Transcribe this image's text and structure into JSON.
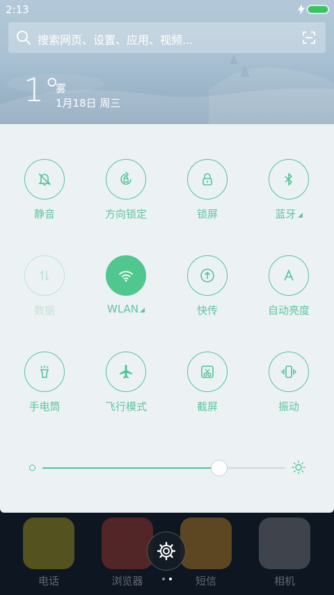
{
  "status": {
    "time": "2:13"
  },
  "search": {
    "placeholder": "搜索网页、设置、应用、视频..."
  },
  "weather": {
    "temp": "1°",
    "condition": "雾",
    "date": "1月18日 周三"
  },
  "toggles": [
    {
      "id": "mute",
      "label": "静音",
      "icon": "bell-off-icon",
      "state": "off"
    },
    {
      "id": "rotation-lock",
      "label": "方向锁定",
      "icon": "rotation-lock-icon",
      "state": "off"
    },
    {
      "id": "lock-screen",
      "label": "锁屏",
      "icon": "lock-icon",
      "state": "off"
    },
    {
      "id": "bluetooth",
      "label": "蓝牙",
      "icon": "bluetooth-icon",
      "state": "off",
      "has_more": true
    },
    {
      "id": "data",
      "label": "数据",
      "icon": "data-arrows-icon",
      "state": "disabled"
    },
    {
      "id": "wlan",
      "label": "WLAN",
      "icon": "wifi-icon",
      "state": "on",
      "has_more": true
    },
    {
      "id": "quick-share",
      "label": "快传",
      "icon": "upload-icon",
      "state": "off"
    },
    {
      "id": "auto-brightness",
      "label": "自动亮度",
      "icon": "auto-a-icon",
      "state": "off"
    },
    {
      "id": "flashlight",
      "label": "手电筒",
      "icon": "flashlight-icon",
      "state": "off"
    },
    {
      "id": "airplane",
      "label": "飞行模式",
      "icon": "airplane-icon",
      "state": "off"
    },
    {
      "id": "screenshot",
      "label": "截屏",
      "icon": "scissors-icon",
      "state": "off"
    },
    {
      "id": "vibrate",
      "label": "振动",
      "icon": "vibrate-icon",
      "state": "off"
    }
  ],
  "brightness": {
    "level": 0.73
  },
  "dock": [
    {
      "label": "电话",
      "color": "#d8c21a"
    },
    {
      "label": "浏览器",
      "color": "#d2452f"
    },
    {
      "label": "短信",
      "color": "#f0a424"
    },
    {
      "label": "相机",
      "color": "#9a9a9a"
    }
  ],
  "colors": {
    "accent": "#4fc496",
    "panel_bg": "#ecf2f4",
    "active_bg": "#4fc78e"
  }
}
